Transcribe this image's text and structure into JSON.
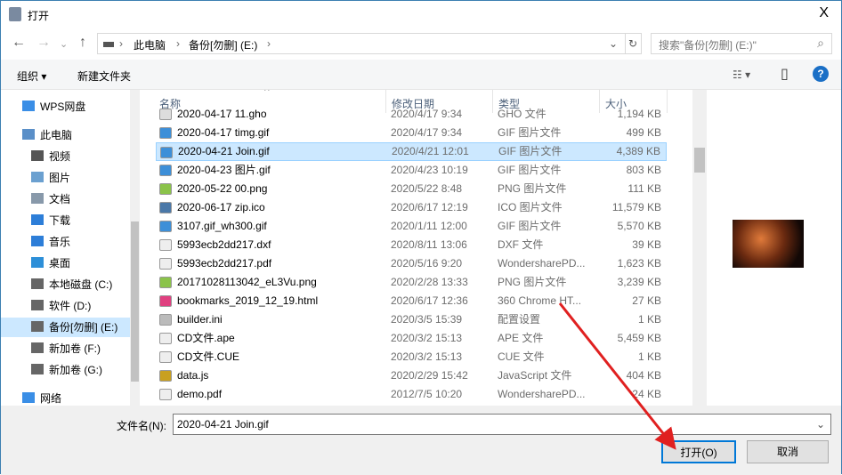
{
  "window": {
    "title": "打开",
    "close": "X"
  },
  "nav": {
    "back": "←",
    "forward": "→",
    "recent": "⌄",
    "up": "↑",
    "breadcrumb": [
      "此电脑",
      "备份[勿删] (E:)"
    ],
    "sep": "›",
    "refresh": "↻",
    "dropdown": "⌄",
    "search_placeholder": "搜索\"备份[勿删] (E:)\"",
    "search_icon": "⌕"
  },
  "toolbar": {
    "organize": "组织 ▾",
    "new_folder": "新建文件夹",
    "view": "☷ ▾",
    "pane": "▯",
    "help": "?"
  },
  "sidebar": {
    "items": [
      {
        "label": "WPS网盘",
        "color": "#3a8ee6"
      },
      {
        "label": "此电脑",
        "color": "#5a8fc8"
      },
      {
        "label": "视频",
        "color": "#555"
      },
      {
        "label": "图片",
        "color": "#6ba0d0"
      },
      {
        "label": "文档",
        "color": "#8899aa"
      },
      {
        "label": "下载",
        "color": "#2d7ed8"
      },
      {
        "label": "音乐",
        "color": "#2d7ed8"
      },
      {
        "label": "桌面",
        "color": "#2d8fd8"
      },
      {
        "label": "本地磁盘 (C:)",
        "color": "#666"
      },
      {
        "label": "软件 (D:)",
        "color": "#666"
      },
      {
        "label": "备份[勿删] (E:)",
        "color": "#666"
      },
      {
        "label": "新加卷 (F:)",
        "color": "#666"
      },
      {
        "label": "新加卷 (G:)",
        "color": "#666"
      },
      {
        "label": "网络",
        "color": "#3a8ee6"
      }
    ]
  },
  "columns": {
    "name": "名称",
    "date": "修改日期",
    "type": "类型",
    "size": "大小"
  },
  "files": [
    {
      "name": "2020-04-17 11.gho",
      "date": "2020/4/17 9:34",
      "type": "GHO 文件",
      "size": "1,194 KB",
      "color": "#ddd"
    },
    {
      "name": "2020-04-17 timg.gif",
      "date": "2020/4/17 9:34",
      "type": "GIF 图片文件",
      "size": "499 KB",
      "color": "#3d8fd8"
    },
    {
      "name": "2020-04-21 Join.gif",
      "date": "2020/4/21 12:01",
      "type": "GIF 图片文件",
      "size": "4,389 KB",
      "color": "#3d8fd8"
    },
    {
      "name": "2020-04-23 图片.gif",
      "date": "2020/4/23 10:19",
      "type": "GIF 图片文件",
      "size": "803 KB",
      "color": "#3d8fd8"
    },
    {
      "name": "2020-05-22 00.png",
      "date": "2020/5/22 8:48",
      "type": "PNG 图片文件",
      "size": "111 KB",
      "color": "#8bc34a"
    },
    {
      "name": "2020-06-17 zip.ico",
      "date": "2020/6/17 12:19",
      "type": "ICO 图片文件",
      "size": "11,579 KB",
      "color": "#4a78a8"
    },
    {
      "name": "3107.gif_wh300.gif",
      "date": "2020/1/11 12:00",
      "type": "GIF 图片文件",
      "size": "5,570 KB",
      "color": "#3d8fd8"
    },
    {
      "name": "5993ecb2dd217.dxf",
      "date": "2020/8/11 13:06",
      "type": "DXF 文件",
      "size": "39 KB",
      "color": "#eee"
    },
    {
      "name": "5993ecb2dd217.pdf",
      "date": "2020/5/16 9:20",
      "type": "WondersharePD...",
      "size": "1,623 KB",
      "color": "#eee"
    },
    {
      "name": "20171028113042_eL3Vu.png",
      "date": "2020/2/28 13:33",
      "type": "PNG 图片文件",
      "size": "3,239 KB",
      "color": "#8bc34a"
    },
    {
      "name": "bookmarks_2019_12_19.html",
      "date": "2020/6/17 12:36",
      "type": "360 Chrome HT...",
      "size": "27 KB",
      "color": "#e04080"
    },
    {
      "name": "builder.ini",
      "date": "2020/3/5 15:39",
      "type": "配置设置",
      "size": "1 KB",
      "color": "#bbb"
    },
    {
      "name": "CD文件.ape",
      "date": "2020/3/2 15:13",
      "type": "APE 文件",
      "size": "5,459 KB",
      "color": "#eee"
    },
    {
      "name": "CD文件.CUE",
      "date": "2020/3/2 15:13",
      "type": "CUE 文件",
      "size": "1 KB",
      "color": "#eee"
    },
    {
      "name": "data.js",
      "date": "2020/2/29 15:42",
      "type": "JavaScript 文件",
      "size": "404 KB",
      "color": "#c9a020"
    },
    {
      "name": "demo.pdf",
      "date": "2012/7/5 10:20",
      "type": "WondersharePD...",
      "size": "24 KB",
      "color": "#eee"
    }
  ],
  "selected_index": 2,
  "bottom": {
    "filename_label": "文件名(N):",
    "filename_value": "2020-04-21 Join.gif",
    "open": "打开(O)",
    "cancel": "取消"
  },
  "accent": "#0078d7",
  "arrow_color": "#e02020"
}
